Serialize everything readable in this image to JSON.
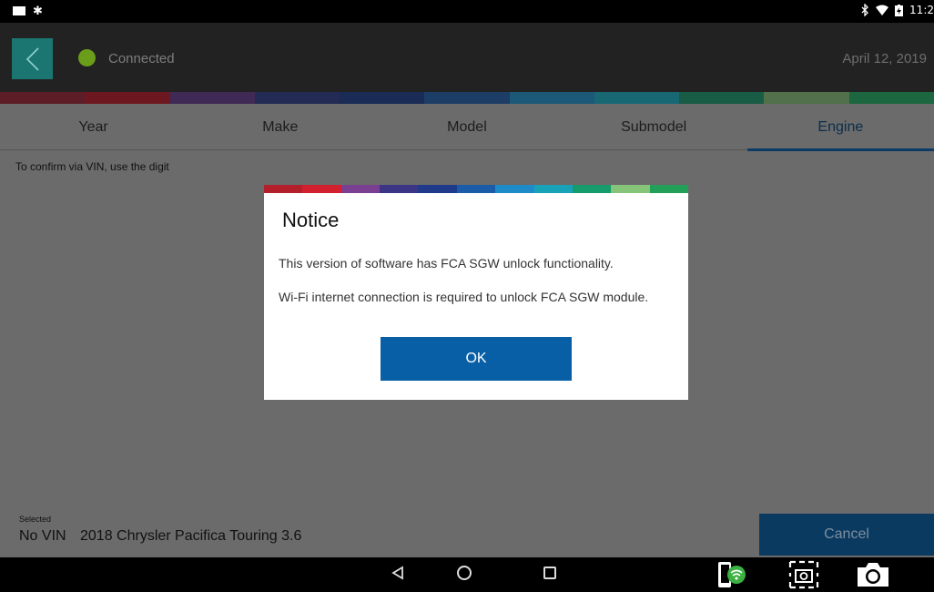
{
  "status_bar": {
    "time": "11:2"
  },
  "header": {
    "connection_status": "Connected",
    "date": "April 12, 2019"
  },
  "tabs": [
    {
      "label": "Year"
    },
    {
      "label": "Make"
    },
    {
      "label": "Model"
    },
    {
      "label": "Submodel"
    },
    {
      "label": "Engine",
      "active": true
    }
  ],
  "instruction": "To confirm via VIN, use the  digit",
  "selected": {
    "caption": "Selected",
    "vin": "No VIN",
    "vehicle": "2018 Chrysler Pacifica Touring 3.6",
    "cancel_label": "Cancel"
  },
  "dialog": {
    "title": "Notice",
    "message1": "This version of software has FCA SGW unlock functionality.",
    "message2": "Wi-Fi internet connection is required to unlock FCA SGW module.",
    "ok_label": "OK"
  },
  "colors": {
    "accent_teal": "#1b7672",
    "connected_green": "#6a9e1a",
    "ok_blue": "#085fa5",
    "strip": [
      "#b3202c",
      "#d3202f",
      "#7a3f91",
      "#3c3585",
      "#1f3a8a",
      "#1a5ca8",
      "#1c8bc8",
      "#17a2b8",
      "#169c6a",
      "#86c47a",
      "#22a05a"
    ]
  },
  "icons": [
    "back-chevron-icon",
    "wifi-app-icon",
    "screenshot-select-icon",
    "camera-icon",
    "bluetooth-icon",
    "wifi-icon",
    "battery-icon"
  ]
}
